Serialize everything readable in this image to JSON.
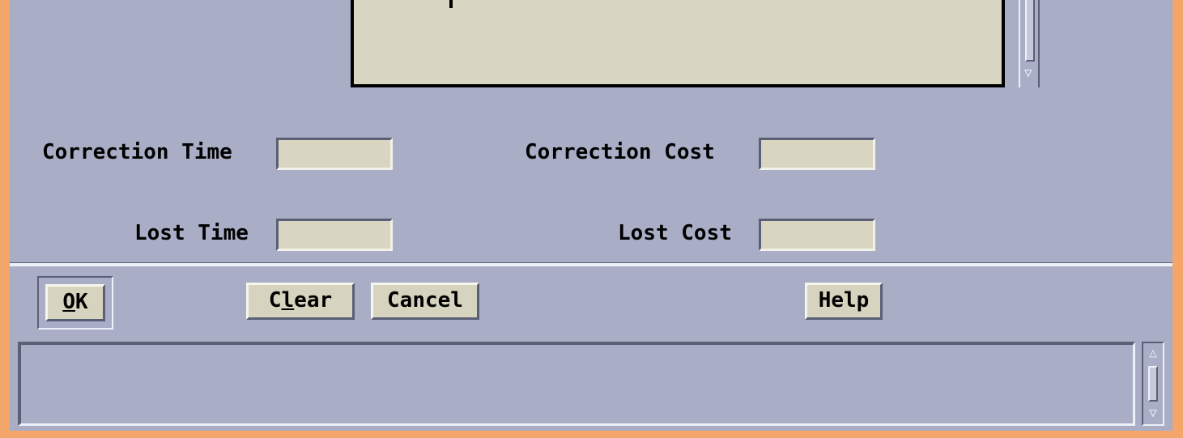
{
  "form": {
    "correction_time_label": "Correction Time",
    "correction_time_value": "",
    "correction_cost_label": "Correction Cost",
    "correction_cost_value": "",
    "lost_time_label": "Lost Time",
    "lost_time_value": "",
    "lost_cost_label": "Lost Cost",
    "lost_cost_value": ""
  },
  "buttons": {
    "ok_mnemonic": "O",
    "ok_rest": "K",
    "clear_before": "C",
    "clear_mnemonic": "l",
    "clear_rest": "ear",
    "cancel_label": "Cancel",
    "help_label": "Help"
  },
  "message_area": {
    "text": ""
  },
  "icons": {
    "scroll_up": "scroll-up-arrow-icon",
    "scroll_down": "scroll-down-arrow-icon"
  },
  "colors": {
    "window_bg": "#a9aec6",
    "field_bg": "#d8d6c0",
    "frame": "#f4a56a"
  }
}
